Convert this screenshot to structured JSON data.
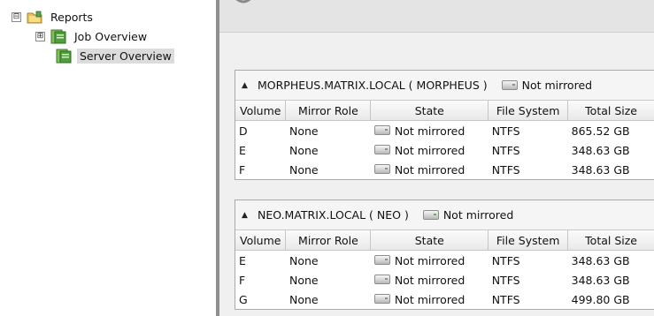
{
  "tree": {
    "root": {
      "label": "Reports",
      "expander": "⊟",
      "icon": "folder-icon"
    },
    "children": [
      {
        "label": "Job Overview",
        "expander": "⊞",
        "icon": "report-icon"
      },
      {
        "label": "Server Overview",
        "icon": "report-icon",
        "selected": true
      }
    ]
  },
  "columns": [
    "Volume",
    "Mirror Role",
    "State",
    "File System",
    "Total Size"
  ],
  "servers": [
    {
      "collapse_glyph": "▲",
      "name": "MORPHEUS.MATRIX.LOCAL  ( MORPHEUS )",
      "status": "Not mirrored",
      "rows": [
        {
          "volume": "D",
          "role": "None",
          "state": "Not mirrored",
          "fs": "NTFS",
          "size": "865.52 GB"
        },
        {
          "volume": "E",
          "role": "None",
          "state": "Not mirrored",
          "fs": "NTFS",
          "size": "348.63 GB"
        },
        {
          "volume": "F",
          "role": "None",
          "state": "Not mirrored",
          "fs": "NTFS",
          "size": "348.63 GB"
        }
      ]
    },
    {
      "collapse_glyph": "▲",
      "name": "NEO.MATRIX.LOCAL  ( NEO )",
      "status": "Not mirrored",
      "rows": [
        {
          "volume": "E",
          "role": "None",
          "state": "Not mirrored",
          "fs": "NTFS",
          "size": "348.63 GB"
        },
        {
          "volume": "F",
          "role": "None",
          "state": "Not mirrored",
          "fs": "NTFS",
          "size": "348.63 GB"
        },
        {
          "volume": "G",
          "role": "None",
          "state": "Not mirrored",
          "fs": "NTFS",
          "size": "499.80 GB"
        }
      ]
    }
  ],
  "colors": {
    "selection": "#dcdcdc",
    "splitter": "#8f8f8f",
    "pane_bg": "#f0f0f0"
  }
}
